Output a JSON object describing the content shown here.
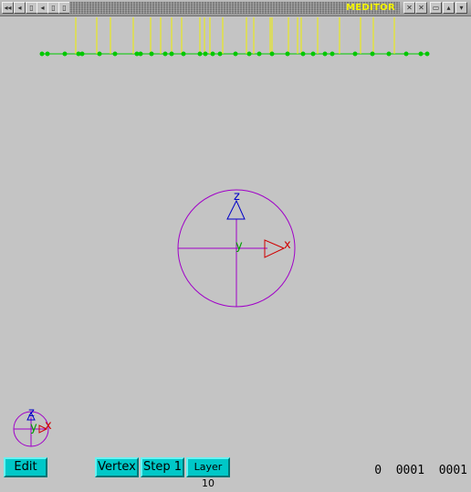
{
  "window": {
    "title": "MEDITOR",
    "left_controls": [
      "◂◂",
      "◂",
      "▯",
      "◂",
      "▯",
      "▯"
    ],
    "right_controls": [
      "✕",
      "✕",
      "▭",
      "▴",
      "▾"
    ]
  },
  "viewport": {
    "axis_labels": {
      "x": "x",
      "y": "y",
      "z": "z"
    },
    "colors": {
      "background": "#c4c4c4",
      "circle": "#a000c8",
      "x_axis": "#d00000",
      "y_axis": "#00a000",
      "z_axis": "#0000c8",
      "track_line": "#00c800",
      "track_node": "#00c800",
      "track_marker": "#f0f000"
    }
  },
  "toolbar": {
    "edit_label": "Edit",
    "vertex_label": "Vertex",
    "step_label": "Step 1",
    "layer_label": "Layer 10",
    "button_color": "#00c8c8"
  },
  "status": {
    "a": "0",
    "b": "0001",
    "c": "0001"
  }
}
